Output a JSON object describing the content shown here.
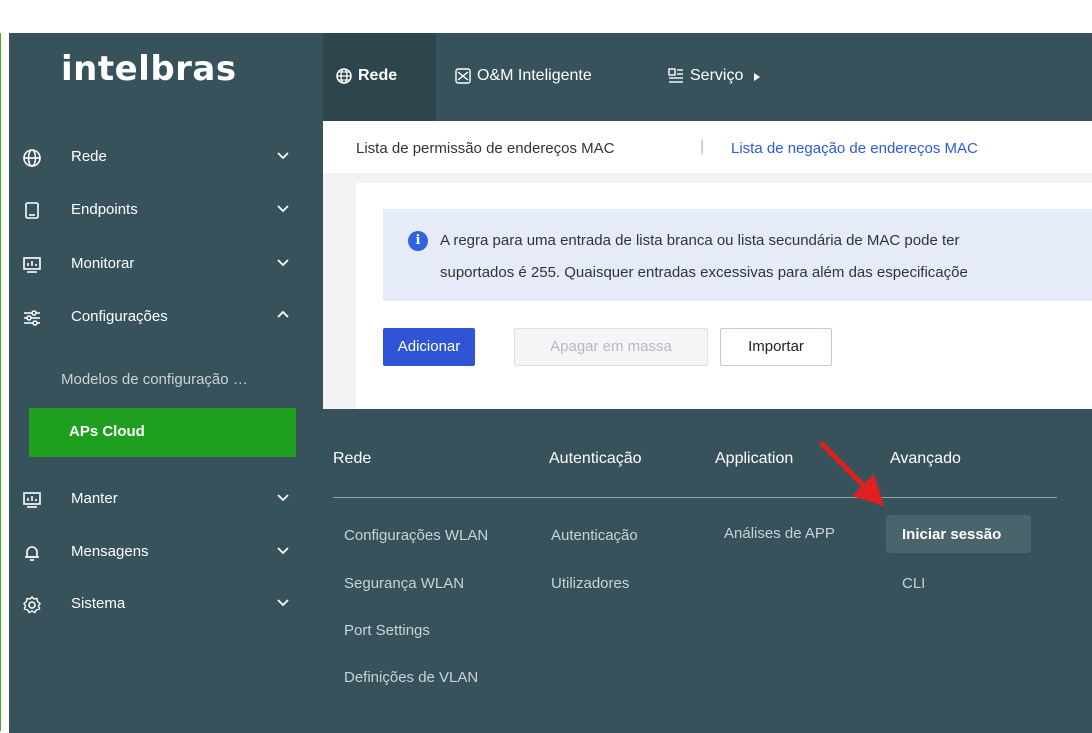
{
  "brand": {
    "logo": "intelbras"
  },
  "sidebar": {
    "items": [
      {
        "label": "Rede",
        "icon": "globe-icon",
        "expanded": false
      },
      {
        "label": "Endpoints",
        "icon": "tablet-icon",
        "expanded": false
      },
      {
        "label": "Monitorar",
        "icon": "monitor-chart-icon",
        "expanded": false
      },
      {
        "label": "Configurações",
        "icon": "sliders-icon",
        "expanded": true
      },
      {
        "label": "Manter",
        "icon": "monitor-chart-icon",
        "expanded": false
      },
      {
        "label": "Mensagens",
        "icon": "bell-icon",
        "expanded": false
      },
      {
        "label": "Sistema",
        "icon": "gear-icon",
        "expanded": false
      }
    ],
    "sub_items": [
      {
        "label": "Modelos de configuração …"
      },
      {
        "label": "APs Cloud",
        "active": true
      }
    ]
  },
  "topnav": {
    "tabs": [
      {
        "label": "Rede",
        "icon": "globe-icon",
        "selected": true
      },
      {
        "label": "O&M Inteligente",
        "icon": "om-icon",
        "selected": false
      },
      {
        "label": "Serviço",
        "icon": "service-icon",
        "selected": false
      }
    ]
  },
  "breadcrumbs": {
    "current": "Lista de permissão de endereços MAC",
    "separator": "|",
    "link": "Lista de negação de endereços MAC"
  },
  "notice": {
    "line1": "A regra para uma entrada de lista branca ou lista secundária de MAC pode ter",
    "line2": "suportados é 255. Quaisquer entradas excessivas para além das especificaçõe"
  },
  "toolbar": {
    "add_label": "Adicionar",
    "bulk_delete_label": "Apagar em massa",
    "import_label": "Importar"
  },
  "dropdown_menu": {
    "columns": [
      {
        "title": "Rede",
        "items": [
          "Configurações WLAN",
          "Segurança WLAN",
          "Port Settings",
          "Definições de VLAN"
        ]
      },
      {
        "title": "Autenticação",
        "items": [
          "Autenticação",
          "Utilizadores"
        ]
      },
      {
        "title": "Application",
        "items": [
          "Análises de APP"
        ]
      },
      {
        "title": "Avançado",
        "items": [
          "Iniciar sessão",
          "CLI"
        ],
        "highlighted": "Iniciar sessão"
      }
    ]
  },
  "colors": {
    "sidebar_bg": "#37525b",
    "active_green": "#1ea01e",
    "primary_blue": "#2f55d4",
    "link_blue": "#2b5bd6",
    "annotation_arrow": "#e02020"
  }
}
